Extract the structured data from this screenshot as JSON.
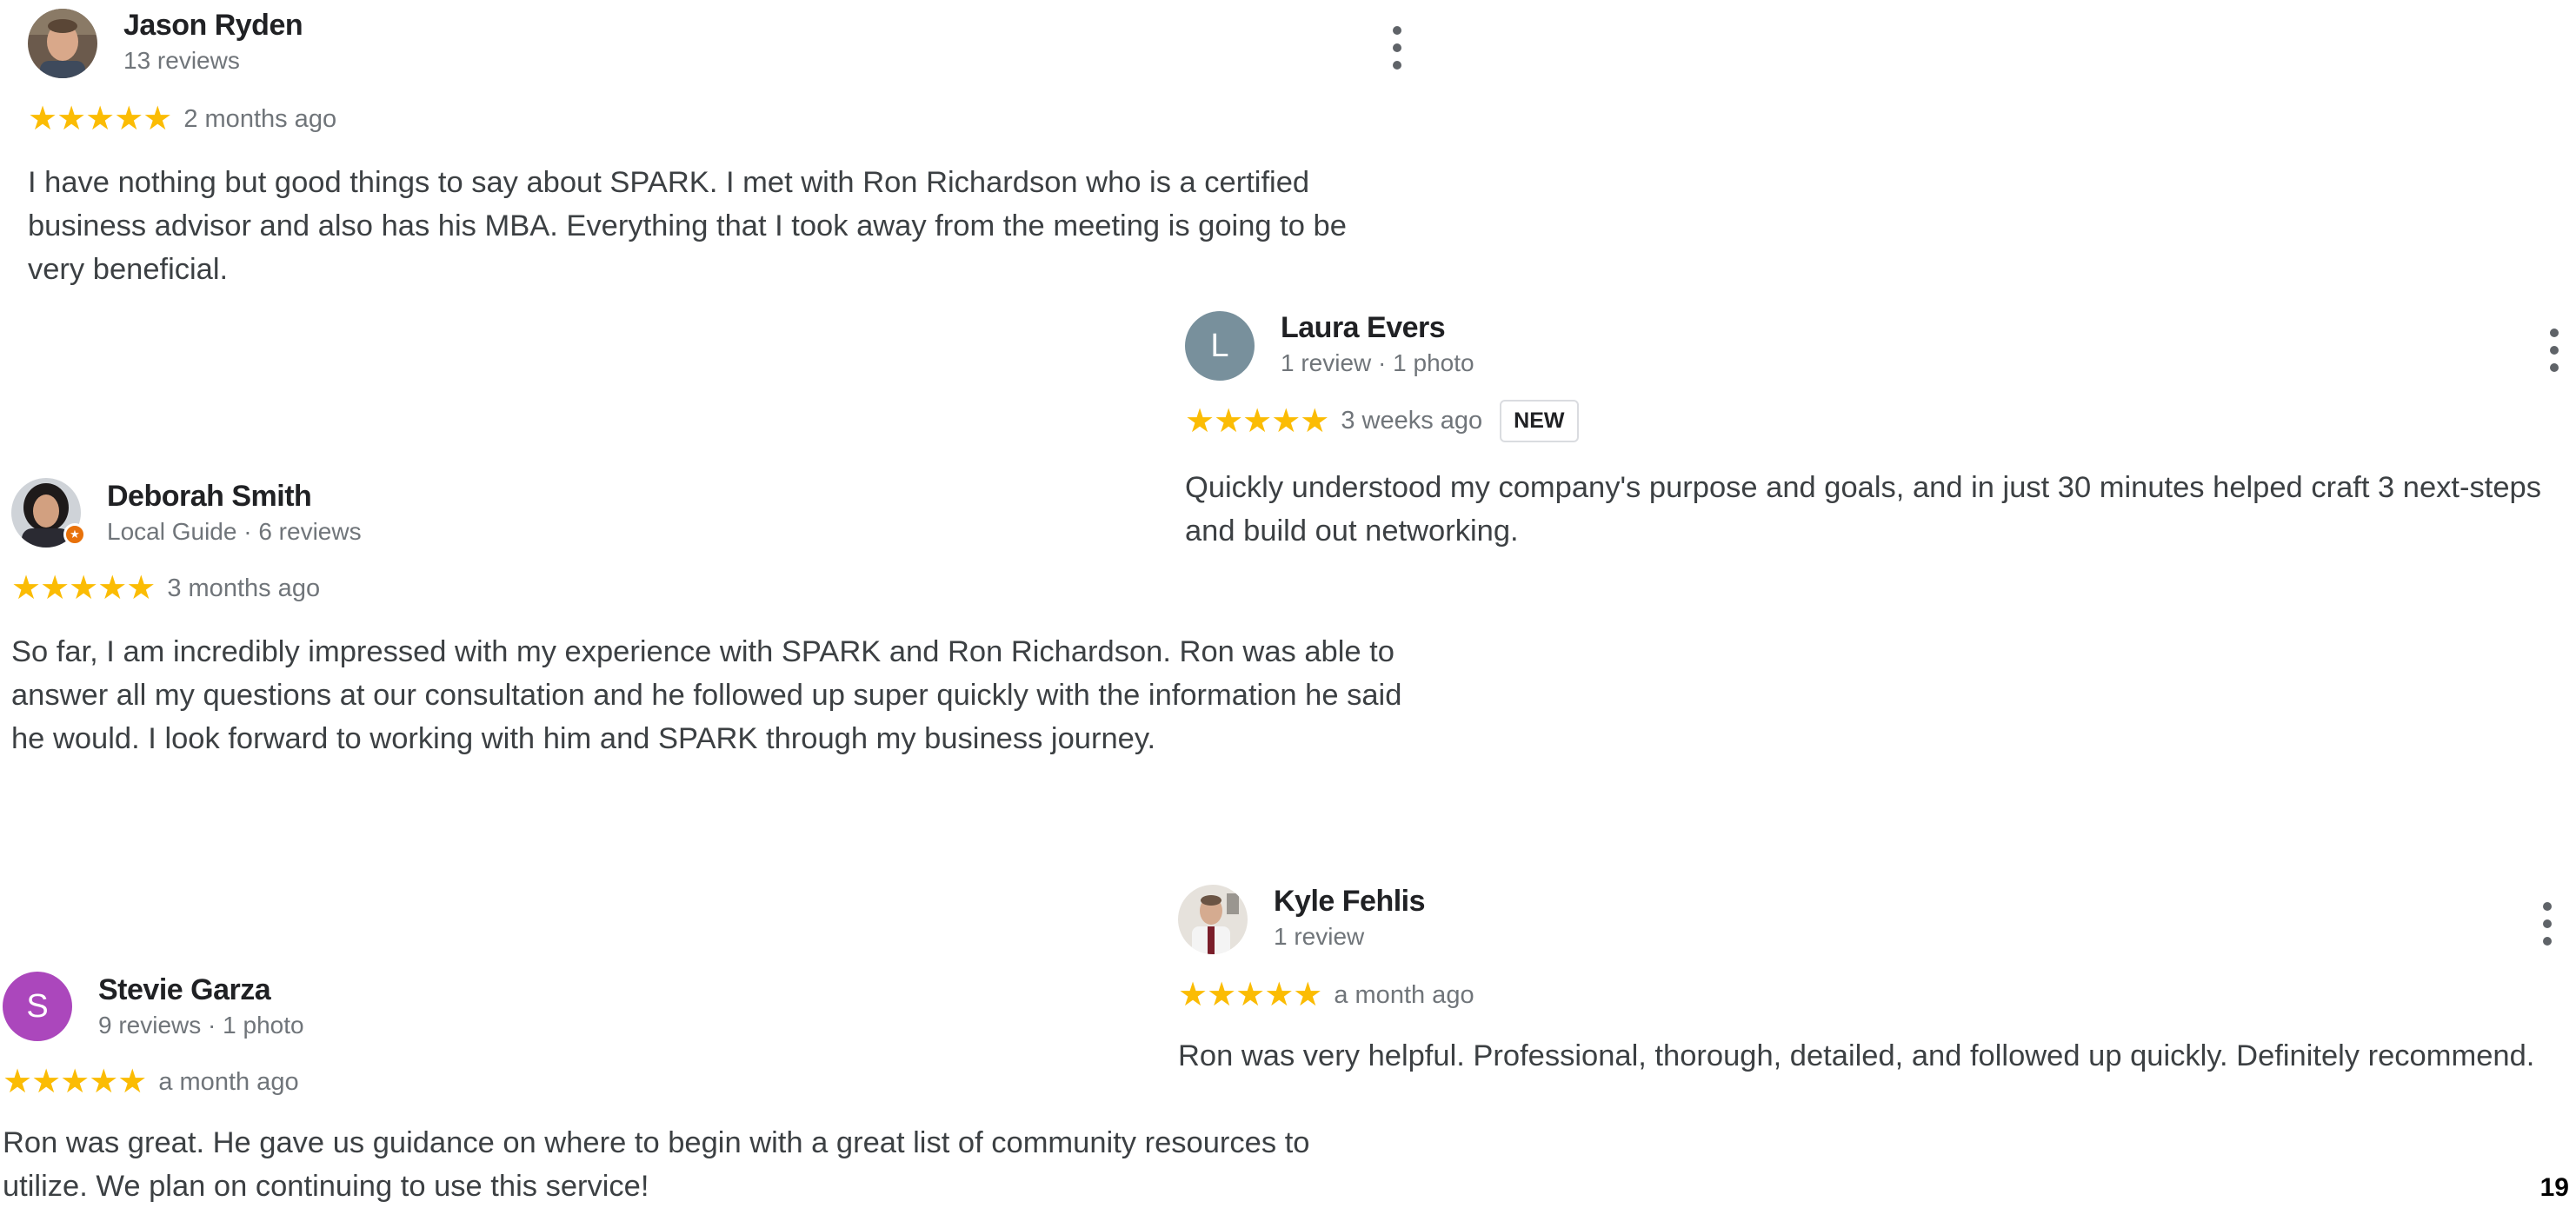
{
  "colors": {
    "star": "#fbbc04",
    "name": "#202124",
    "meta": "#70757a",
    "text": "#3c4043",
    "avatar_laura": "#78909c",
    "avatar_stevie": "#ab47bc",
    "local_guide_badge": "#e8710a"
  },
  "icons": {
    "menu": "more-vertical-icon",
    "rating": "star-icon",
    "local_guide": "local-guide-star-icon"
  },
  "reviews": [
    {
      "name": "Jason Ryden",
      "meta": "13 reviews",
      "stars": "★★★★★",
      "rating": 5,
      "time": "2 months ago",
      "text": "I have nothing but good things to say about SPARK. I met with Ron Richardson who is a certified business advisor and also has his MBA. Everything that I took away from the meeting is going to be very beneficial."
    },
    {
      "name": "Laura Evers",
      "avatar_letter": "L",
      "meta": "1 review · 1 photo",
      "stars": "★★★★★",
      "rating": 5,
      "time": "3 weeks ago",
      "badge": "NEW",
      "text": "Quickly understood my company's purpose and goals, and in just 30 minutes helped craft 3 next-steps and build out networking."
    },
    {
      "name": "Deborah Smith",
      "meta": "Local Guide · 6 reviews",
      "stars": "★★★★★",
      "rating": 5,
      "time": "3 months ago",
      "text": "So far, I am incredibly impressed with my experience with SPARK and Ron Richardson. Ron was able to answer all my questions at our consultation and he followed up super quickly with the information he said he would. I look forward to working with him and SPARK through my business journey."
    },
    {
      "name": "Kyle Fehlis",
      "meta": "1 review",
      "stars": "★★★★★",
      "rating": 5,
      "time": "a month ago",
      "text": "Ron was very helpful. Professional, thorough, detailed, and followed up quickly. Definitely recommend."
    },
    {
      "name": "Stevie Garza",
      "avatar_letter": "S",
      "meta": "9 reviews · 1 photo",
      "stars": "★★★★★",
      "rating": 5,
      "time": "a month ago",
      "text": "Ron was great. He gave us guidance on where to begin with a great list of community resources to utilize. We plan on continuing to use this service!"
    }
  ],
  "page_number": "19"
}
